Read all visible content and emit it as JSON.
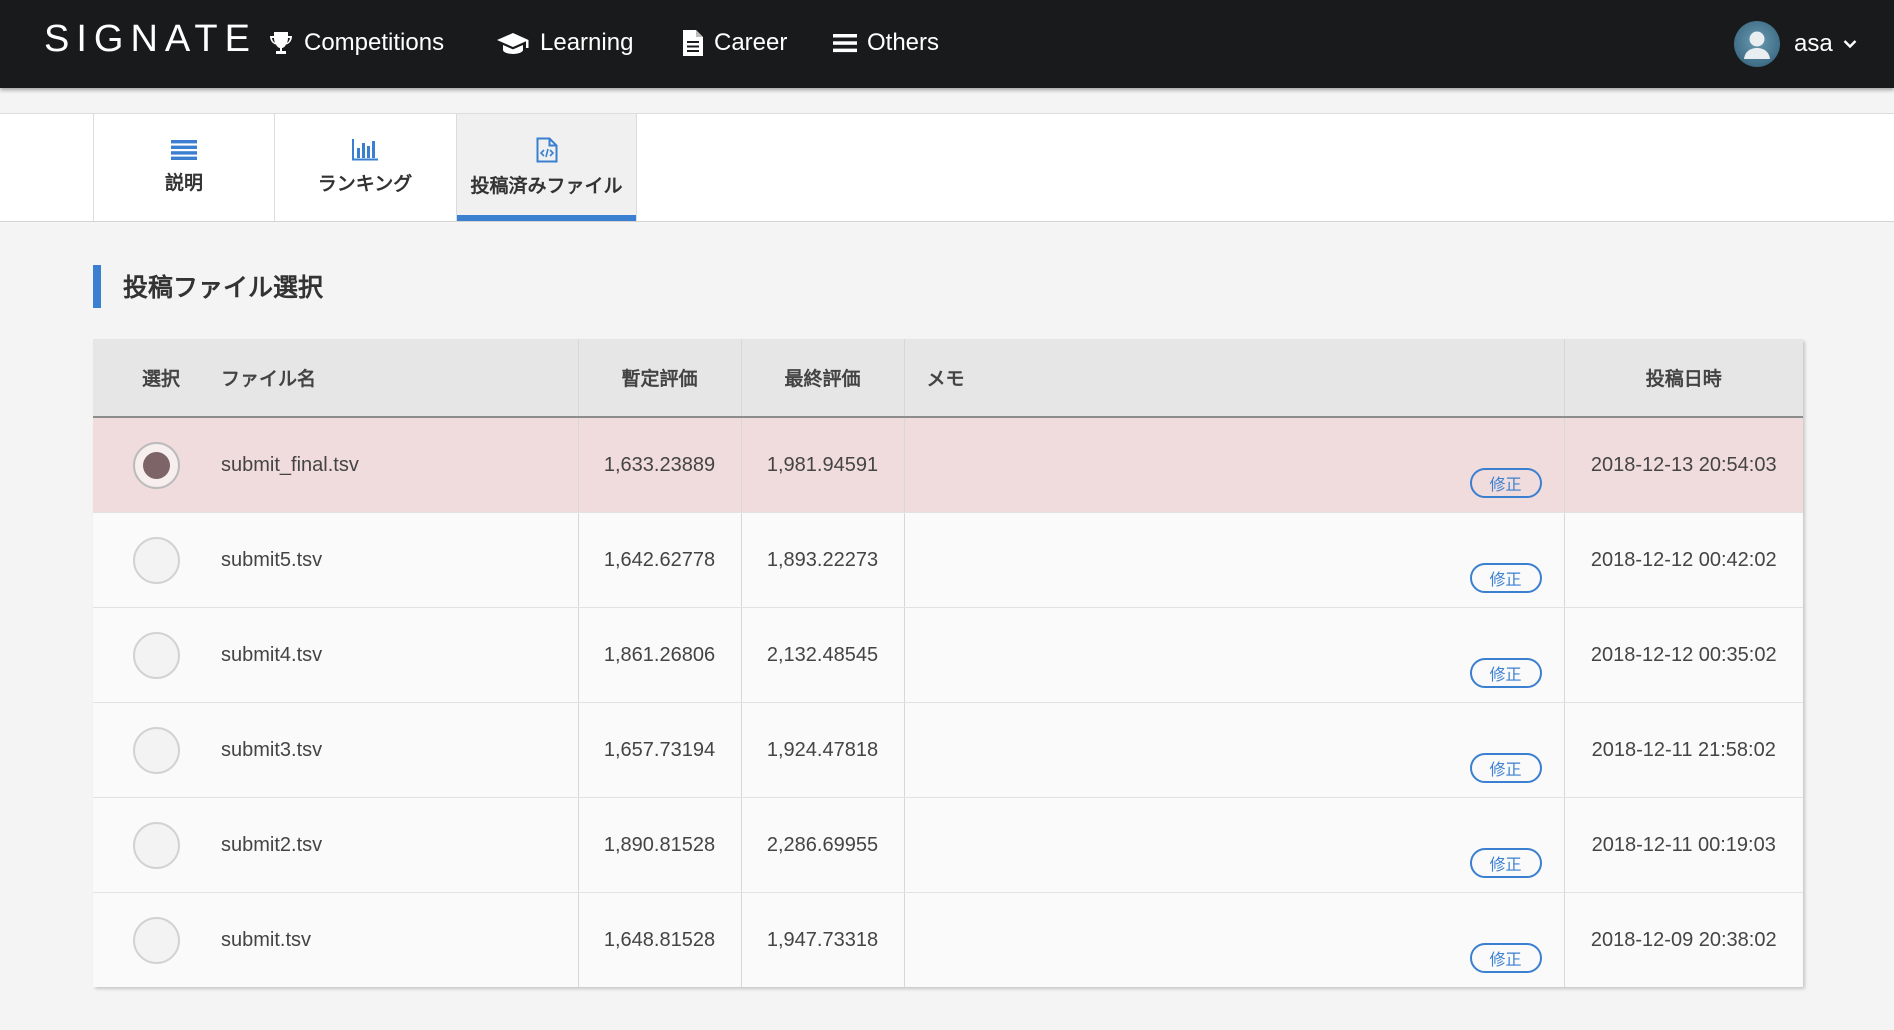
{
  "brand": {
    "logo": "SIGNATE"
  },
  "nav": [
    {
      "label": "Competitions",
      "icon": "trophy-icon"
    },
    {
      "label": "Learning",
      "icon": "graduation-cap-icon"
    },
    {
      "label": "Career",
      "icon": "document-icon"
    },
    {
      "label": "Others",
      "icon": "menu-icon"
    }
  ],
  "user": {
    "name": "asa"
  },
  "tabs": [
    {
      "label": "説明",
      "icon": "list-icon"
    },
    {
      "label": "ランキング",
      "icon": "bar-chart-icon"
    },
    {
      "label": "投稿済みファイル",
      "icon": "code-file-icon",
      "active": true
    }
  ],
  "section": {
    "title": "投稿ファイル選択"
  },
  "table": {
    "headers": {
      "select": "選択",
      "filename": "ファイル名",
      "provisional": "暫定評価",
      "final": "最終評価",
      "memo": "メモ",
      "date": "投稿日時"
    },
    "edit_label": "修正",
    "rows": [
      {
        "filename": "submit_final.tsv",
        "provisional": "1,633.23889",
        "final": "1,981.94591",
        "memo": "",
        "date": "2018-12-13 20:54:03",
        "selected": true
      },
      {
        "filename": "submit5.tsv",
        "provisional": "1,642.62778",
        "final": "1,893.22273",
        "memo": "",
        "date": "2018-12-12 00:42:02",
        "selected": false
      },
      {
        "filename": "submit4.tsv",
        "provisional": "1,861.26806",
        "final": "2,132.48545",
        "memo": "",
        "date": "2018-12-12 00:35:02",
        "selected": false
      },
      {
        "filename": "submit3.tsv",
        "provisional": "1,657.73194",
        "final": "1,924.47818",
        "memo": "",
        "date": "2018-12-11 21:58:02",
        "selected": false
      },
      {
        "filename": "submit2.tsv",
        "provisional": "1,890.81528",
        "final": "2,286.69955",
        "memo": "",
        "date": "2018-12-11 00:19:03",
        "selected": false
      },
      {
        "filename": "submit.tsv",
        "provisional": "1,648.81528",
        "final": "1,947.73318",
        "memo": "",
        "date": "2018-12-09 20:38:02",
        "selected": false
      }
    ]
  },
  "colors": {
    "navbar": "#181a1b",
    "accent": "#3a7fd0",
    "selected_row": "#f1dcdd"
  }
}
